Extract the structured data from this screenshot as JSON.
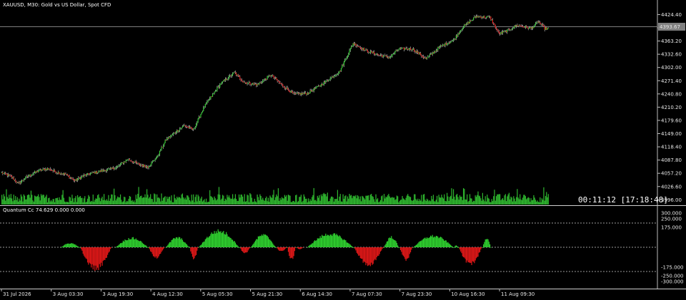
{
  "window": {
    "symbol_title": "XAUUSD, M30:  Gold vs US Dollar, Spot CFD",
    "timer": "00:11:12 [17:18:48]",
    "current_price_label": "4393.67"
  },
  "indicator": {
    "title": "Quantum Cc 74.629 0.000 0.000"
  },
  "colors": {
    "background": "#000000",
    "bull": "#2fd12f",
    "bear": "#e01818",
    "wick": "#cfcfcf",
    "volume": "#2fb62f",
    "grid_line": "#808080",
    "text": "#e8e8e8"
  },
  "chart_data": [
    {
      "type": "candlestick",
      "title": "XAUUSD, M30:  Gold vs US Dollar, Spot CFD",
      "y_tick_labels": [
        "4424.40",
        "4393.80",
        "4363.20",
        "4332.60",
        "4302.00",
        "4271.40",
        "4240.80",
        "4210.20",
        "4179.60",
        "4149.00",
        "4118.40",
        "4087.80",
        "4057.20",
        "4026.60",
        "3996.00"
      ],
      "ylim": [
        3985,
        4435
      ],
      "current_price": 4393.67,
      "x_tick_labels": [
        "31 Jul 2026",
        "3 Aug 03:30",
        "3 Aug 19:30",
        "4 Aug 12:30",
        "5 Aug 05:30",
        "5 Aug 21:30",
        "6 Aug 14:30",
        "7 Aug 07:30",
        "7 Aug 23:30",
        "10 Aug 16:30",
        "11 Aug 09:30"
      ],
      "close_anchors": [
        [
          0,
          4058
        ],
        [
          10,
          4050
        ],
        [
          18,
          4033
        ],
        [
          28,
          4050
        ],
        [
          40,
          4063
        ],
        [
          50,
          4068
        ],
        [
          60,
          4060
        ],
        [
          70,
          4055
        ],
        [
          80,
          4040
        ],
        [
          90,
          4052
        ],
        [
          100,
          4058
        ],
        [
          110,
          4063
        ],
        [
          125,
          4070
        ],
        [
          138,
          4090
        ],
        [
          150,
          4078
        ],
        [
          160,
          4072
        ],
        [
          170,
          4095
        ],
        [
          180,
          4135
        ],
        [
          190,
          4152
        ],
        [
          200,
          4168
        ],
        [
          210,
          4158
        ],
        [
          222,
          4212
        ],
        [
          240,
          4265
        ],
        [
          255,
          4290
        ],
        [
          265,
          4268
        ],
        [
          280,
          4262
        ],
        [
          295,
          4285
        ],
        [
          305,
          4265
        ],
        [
          320,
          4240
        ],
        [
          335,
          4242
        ],
        [
          350,
          4262
        ],
        [
          370,
          4292
        ],
        [
          385,
          4358
        ],
        [
          400,
          4340
        ],
        [
          415,
          4330
        ],
        [
          425,
          4325
        ],
        [
          435,
          4345
        ],
        [
          450,
          4345
        ],
        [
          465,
          4322
        ],
        [
          480,
          4350
        ],
        [
          495,
          4365
        ],
        [
          505,
          4395
        ],
        [
          520,
          4420
        ],
        [
          535,
          4418
        ],
        [
          545,
          4380
        ],
        [
          555,
          4388
        ],
        [
          565,
          4400
        ],
        [
          580,
          4392
        ],
        [
          588,
          4408
        ],
        [
          595,
          4392
        ]
      ],
      "volume": "green histogram along chart bottom"
    },
    {
      "type": "histogram",
      "title": "Quantum Cc 74.629 0.000 0.000",
      "y_tick_labels": [
        "300.000",
        "250.000",
        "175.000",
        "-175.000",
        "-250.000",
        "-300.000"
      ],
      "ylim": [
        -305,
        305
      ],
      "levels": [
        175,
        -175
      ],
      "segments": [
        {
          "start": 65,
          "end": 85,
          "peak": 40
        },
        {
          "start": 86,
          "end": 120,
          "peak": -210
        },
        {
          "start": 125,
          "end": 160,
          "peak": 90
        },
        {
          "start": 161,
          "end": 178,
          "peak": -100
        },
        {
          "start": 180,
          "end": 205,
          "peak": 95
        },
        {
          "start": 206,
          "end": 215,
          "peak": -110
        },
        {
          "start": 216,
          "end": 260,
          "peak": 160
        },
        {
          "start": 261,
          "end": 272,
          "peak": -60
        },
        {
          "start": 273,
          "end": 300,
          "peak": 120
        },
        {
          "start": 301,
          "end": 312,
          "peak": -40
        },
        {
          "start": 313,
          "end": 322,
          "peak": -120
        },
        {
          "start": 323,
          "end": 330,
          "peak": -20
        },
        {
          "start": 335,
          "end": 385,
          "peak": 130
        },
        {
          "start": 386,
          "end": 418,
          "peak": -170
        },
        {
          "start": 419,
          "end": 435,
          "peak": 100
        },
        {
          "start": 436,
          "end": 450,
          "peak": -120
        },
        {
          "start": 451,
          "end": 495,
          "peak": 110
        },
        {
          "start": 496,
          "end": 500,
          "peak": 20
        },
        {
          "start": 501,
          "end": 526,
          "peak": -170
        },
        {
          "start": 527,
          "end": 536,
          "peak": 80
        }
      ]
    }
  ]
}
